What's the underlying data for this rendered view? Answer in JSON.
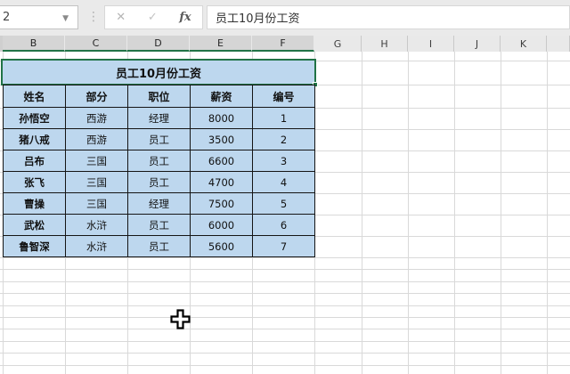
{
  "formula_bar": {
    "name_box_value": "2",
    "cancel_glyph": "✕",
    "enter_glyph": "✓",
    "fx_glyph": "fx",
    "content": "员工10月份工资"
  },
  "columns": [
    {
      "label": "B",
      "selected": true
    },
    {
      "label": "C",
      "selected": true
    },
    {
      "label": "D",
      "selected": true
    },
    {
      "label": "E",
      "selected": true
    },
    {
      "label": "F",
      "selected": true
    },
    {
      "label": "G",
      "selected": false
    },
    {
      "label": "H",
      "selected": false
    },
    {
      "label": "I",
      "selected": false
    },
    {
      "label": "J",
      "selected": false
    },
    {
      "label": "K",
      "selected": false
    }
  ],
  "table": {
    "title": "员工10月份工资",
    "headers": [
      "姓名",
      "部分",
      "职位",
      "薪资",
      "编号"
    ],
    "rows": [
      [
        "孙悟空",
        "西游",
        "经理",
        "8000",
        "1"
      ],
      [
        "猪八戒",
        "西游",
        "员工",
        "3500",
        "2"
      ],
      [
        "吕布",
        "三国",
        "员工",
        "6600",
        "3"
      ],
      [
        "张飞",
        "三国",
        "员工",
        "4700",
        "4"
      ],
      [
        "曹操",
        "三国",
        "经理",
        "7500",
        "5"
      ],
      [
        "武松",
        "水浒",
        "员工",
        "6000",
        "6"
      ],
      [
        "鲁智深",
        "水浒",
        "员工",
        "5600",
        "7"
      ]
    ]
  },
  "colors": {
    "cell_fill": "#BDD7EE",
    "selection_green": "#217346",
    "gridline": "#D9D9D9",
    "header_bg": "#E9E9E9",
    "header_selected_bg": "#D5D5D5"
  }
}
